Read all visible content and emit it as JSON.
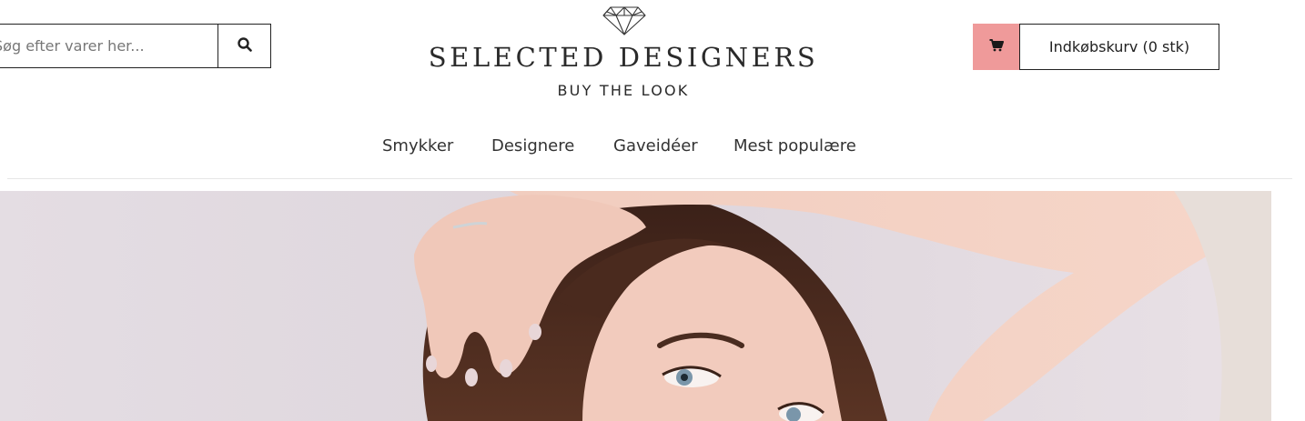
{
  "search": {
    "placeholder": "Søg efter varer her...",
    "button_icon": "search-icon"
  },
  "logo": {
    "title": "SELECTED DESIGNERS",
    "tagline": "BUY THE LOOK",
    "icon": "diamond-icon"
  },
  "cart": {
    "label": "Indkøbskurv (0 stk)",
    "icon": "cart-icon",
    "accent_color": "#ef9a9a"
  },
  "nav": {
    "items": [
      "Smykker",
      "Designere",
      "Gaveidéer",
      "Mest populære"
    ]
  },
  "hero": {
    "image": "hero-model-photo"
  }
}
